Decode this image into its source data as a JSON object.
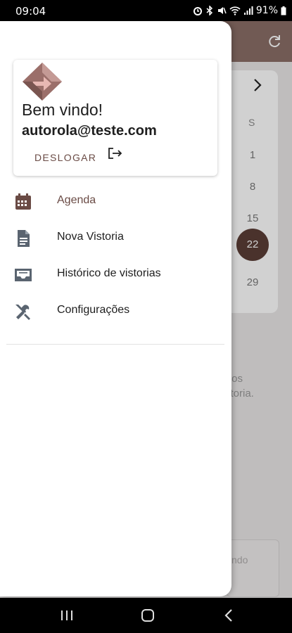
{
  "status_bar": {
    "time": "09:04",
    "battery": "91%",
    "icons": [
      "alarm-icon",
      "bluetooth-icon",
      "mute-icon",
      "wifi-icon",
      "signal-icon",
      "battery-icon"
    ]
  },
  "background": {
    "calendar": {
      "day_of_week": "S",
      "days": [
        "1",
        "8",
        "15",
        "22",
        "29"
      ],
      "selected_day": "22"
    },
    "partial_text_line1": "r os",
    "partial_text_line2": "storia.",
    "partial_card_text": "ndo"
  },
  "drawer": {
    "welcome": "Bem vindo!",
    "email": "autorola@teste.com",
    "logout_label": "DESLOGAR",
    "menu": [
      {
        "label": "Agenda",
        "icon": "calendar-icon",
        "active": true
      },
      {
        "label": "Nova Vistoria",
        "icon": "document-icon",
        "active": false
      },
      {
        "label": "Histórico de vistorias",
        "icon": "inbox-icon",
        "active": false
      },
      {
        "label": "Configurações",
        "icon": "tools-icon",
        "active": false
      }
    ]
  },
  "colors": {
    "accent": "#6a4b45",
    "accent_dark": "#5b3e36",
    "header": "#8a6e67",
    "icon_gray": "#5a6470"
  }
}
